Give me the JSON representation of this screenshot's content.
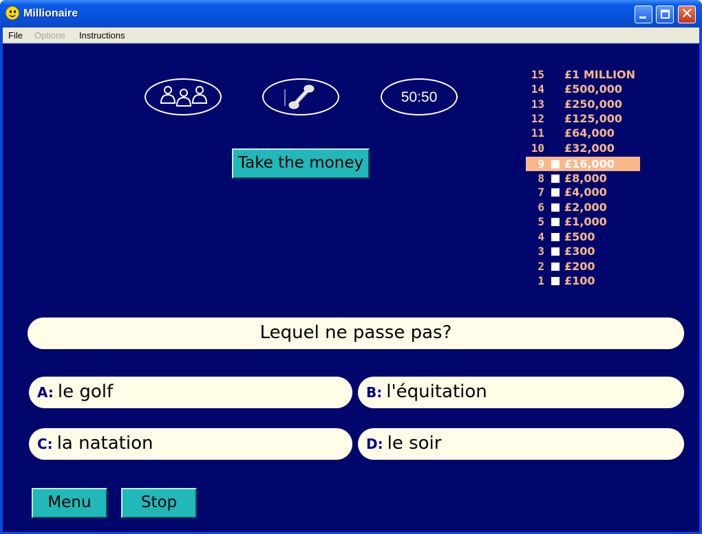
{
  "window": {
    "title": "Millionaire"
  },
  "menu": {
    "file": "File",
    "options": "Options",
    "instructions": "Instructions"
  },
  "lifelines": {
    "ask_audience": "ask-audience",
    "phone_friend": "phone-a-friend",
    "fifty_fifty": "50:50"
  },
  "buttons": {
    "take_money": "Take the money",
    "menu": "Menu",
    "stop": "Stop"
  },
  "ladder": [
    {
      "level": "15",
      "prize": "£1 MILLION",
      "box": false,
      "current": false
    },
    {
      "level": "14",
      "prize": "£500,000",
      "box": false,
      "current": false
    },
    {
      "level": "13",
      "prize": "£250,000",
      "box": false,
      "current": false
    },
    {
      "level": "12",
      "prize": "£125,000",
      "box": false,
      "current": false
    },
    {
      "level": "11",
      "prize": "£64,000",
      "box": false,
      "current": false
    },
    {
      "level": "10",
      "prize": "£32,000",
      "box": false,
      "current": false
    },
    {
      "level": "9",
      "prize": "£16,000",
      "box": true,
      "current": true
    },
    {
      "level": "8",
      "prize": "£8,000",
      "box": true,
      "current": false
    },
    {
      "level": "7",
      "prize": "£4,000",
      "box": true,
      "current": false
    },
    {
      "level": "6",
      "prize": "£2,000",
      "box": true,
      "current": false
    },
    {
      "level": "5",
      "prize": "£1,000",
      "box": true,
      "current": false
    },
    {
      "level": "4",
      "prize": "£500",
      "box": true,
      "current": false
    },
    {
      "level": "3",
      "prize": "£300",
      "box": true,
      "current": false
    },
    {
      "level": "2",
      "prize": "£200",
      "box": true,
      "current": false
    },
    {
      "level": "1",
      "prize": "£100",
      "box": true,
      "current": false
    }
  ],
  "question": "Lequel ne passe pas?",
  "answers": [
    {
      "letter": "A:",
      "text": "le golf"
    },
    {
      "letter": "B:",
      "text": "l'équitation"
    },
    {
      "letter": "C:",
      "text": "la natation"
    },
    {
      "letter": "D:",
      "text": "le soir"
    }
  ],
  "colors": {
    "background": "#00066b",
    "ladder_text": "#f8b888",
    "highlight": "#f8b888",
    "button": "#20b8b8",
    "pill": "#fffde8"
  }
}
